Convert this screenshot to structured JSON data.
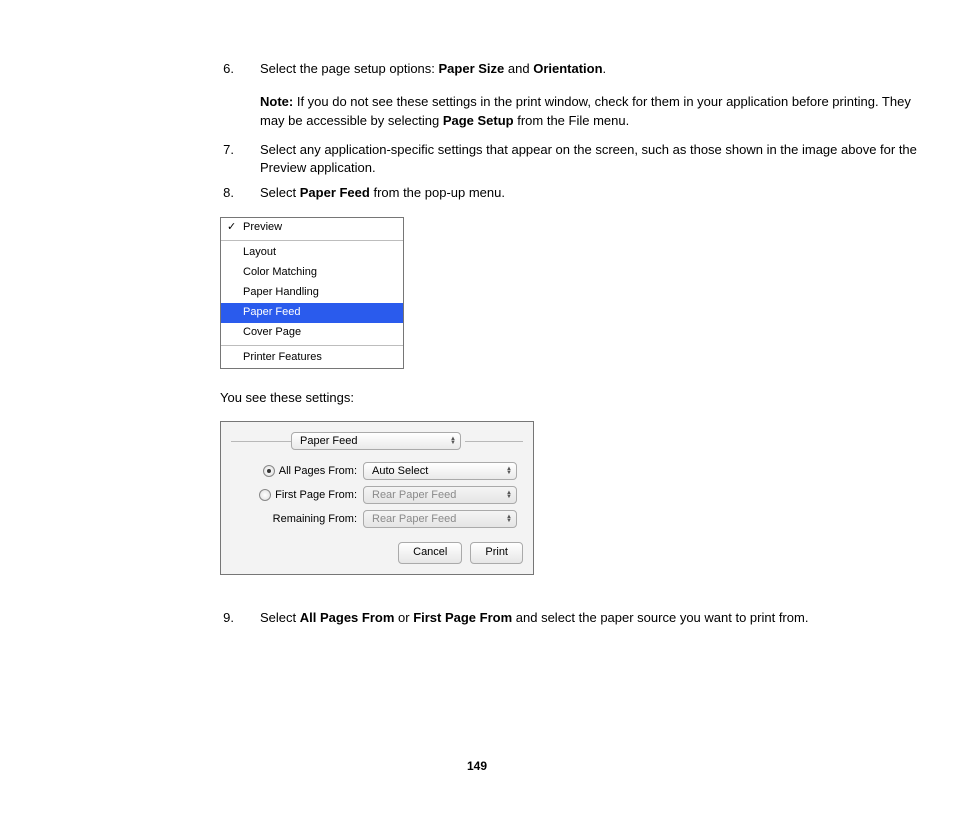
{
  "steps": {
    "s6": {
      "num": "6.",
      "prefix": "Select the page setup options: ",
      "b1": "Paper Size",
      "mid": " and ",
      "b2": "Orientation",
      "suffix": ".",
      "note_label": "Note:",
      "note_body_a": " If you do not see these settings in the print window, check for them in your application before printing. They may be accessible by selecting ",
      "note_bold": "Page Setup",
      "note_body_b": " from the File menu."
    },
    "s7": {
      "num": "7.",
      "text": "Select any application-specific settings that appear on the screen, such as those shown in the image above for the Preview application."
    },
    "s8": {
      "num": "8.",
      "prefix": "Select ",
      "bold": "Paper Feed",
      "suffix": " from the pop-up menu."
    },
    "s9": {
      "num": "9.",
      "prefix": "Select ",
      "b1": "All Pages From",
      "mid": " or ",
      "b2": "First Page From",
      "suffix": " and select the paper source you want to print from."
    }
  },
  "menu": {
    "preview": "Preview",
    "layout": "Layout",
    "color_matching": "Color Matching",
    "paper_handling": "Paper Handling",
    "paper_feed": "Paper Feed",
    "cover_page": "Cover Page",
    "printer_features": "Printer Features"
  },
  "caption_after_menu": "You see these settings:",
  "dialog": {
    "title": "Paper Feed",
    "all_pages_label": "All Pages From:",
    "all_pages_value": "Auto Select",
    "first_page_label": "First Page From:",
    "first_page_value": "Rear Paper Feed",
    "remaining_label": "Remaining From:",
    "remaining_value": "Rear Paper Feed",
    "cancel": "Cancel",
    "print": "Print"
  },
  "page_number": "149"
}
